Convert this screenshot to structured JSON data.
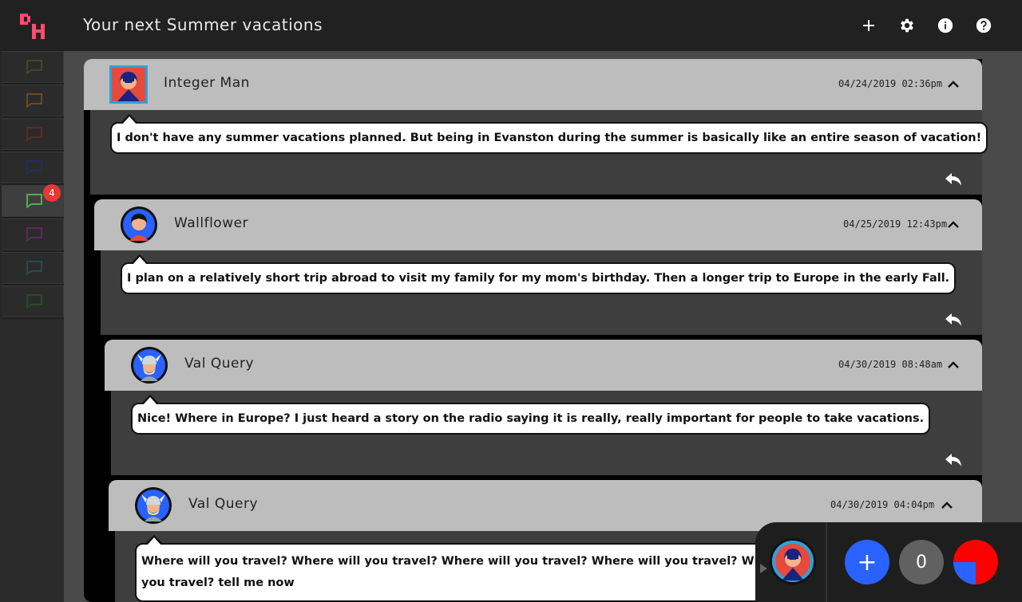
{
  "app": {
    "title": "Your next Summer vacations",
    "logo_text": "DH",
    "accent": "#ff4b6e"
  },
  "toolbar": {
    "add_icon": "plus-icon",
    "settings_icon": "gear-icon",
    "info_icon": "info-icon",
    "help_icon": "help-icon"
  },
  "sidebar": {
    "items": [
      {
        "icon": "chat-icon",
        "color": "#3a4a2a"
      },
      {
        "icon": "chat-icon",
        "color": "#6a4a22"
      },
      {
        "icon": "chat-icon",
        "color": "#5a2a2a"
      },
      {
        "icon": "chat-icon",
        "color": "#2a2a5a"
      },
      {
        "icon": "chat-icon",
        "color": "#4caf50",
        "badge": "4"
      },
      {
        "icon": "chat-icon",
        "color": "#5a2a5a"
      },
      {
        "icon": "chat-icon",
        "color": "#2a4a4a"
      },
      {
        "icon": "chat-icon",
        "color": "#2a4a2a"
      }
    ]
  },
  "posts": [
    {
      "author": "Integer Man",
      "timestamp": "04/24/2019 02:36pm",
      "text": "I don't have any summer vacations planned. But being in Evanston during the summer is basically like an entire season of vacation!"
    },
    {
      "author": "Wallflower",
      "timestamp": "04/25/2019 12:43pm",
      "text": "I plan on a relatively short trip abroad to visit my family for my mom's birthday. Then a longer trip to Europe in the early Fall."
    },
    {
      "author": "Val Query",
      "timestamp": "04/30/2019 08:48am",
      "text": "Nice! Where in Europe? I just heard a story on the radio saying it is really, really important for people to take vacations."
    },
    {
      "author": "Val Query",
      "timestamp": "04/30/2019 04:04pm",
      "text": "Where will you travel? Where will you travel? Where will you travel? Where will you travel? Where will you travel? Where will you travel? tell me now"
    }
  ],
  "dock": {
    "add_label": "+",
    "count": "0",
    "pie_fraction": 0.25
  }
}
